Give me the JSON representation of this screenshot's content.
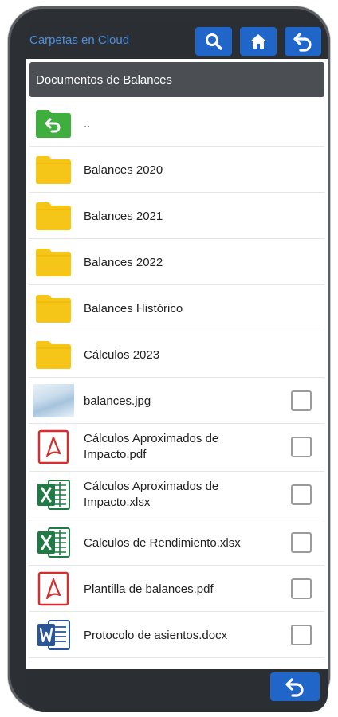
{
  "app": {
    "title": "Carpetas en Cloud"
  },
  "toolbar": {
    "search_icon": "search-icon",
    "home_icon": "home-icon",
    "back_icon": "back-arrow-icon"
  },
  "breadcrumb": {
    "title": "Documentos de Balances"
  },
  "items": [
    {
      "label": "..",
      "type": "parent"
    },
    {
      "label": "Balances 2020",
      "type": "folder"
    },
    {
      "label": "Balances 2021",
      "type": "folder"
    },
    {
      "label": "Balances 2022",
      "type": "folder"
    },
    {
      "label": "Balances Histórico",
      "type": "folder"
    },
    {
      "label": "Cálculos 2023",
      "type": "folder"
    },
    {
      "label": "balances.jpg",
      "type": "image"
    },
    {
      "label": "Cálculos Aproximados de Impacto.pdf",
      "type": "pdf"
    },
    {
      "label": "Cálculos Aproximados de Impacto.xlsx",
      "type": "xlsx"
    },
    {
      "label": "Calculos de Rendimiento.xlsx",
      "type": "xlsx"
    },
    {
      "label": "Plantilla de balances.pdf",
      "type": "pdf"
    },
    {
      "label": "Protocolo de asientos.docx",
      "type": "docx"
    }
  ],
  "colors": {
    "accent": "#1f66c8",
    "folder": "#f5c518",
    "excel": "#1f7a45",
    "pdf": "#d32f2f",
    "word": "#2a5699"
  }
}
